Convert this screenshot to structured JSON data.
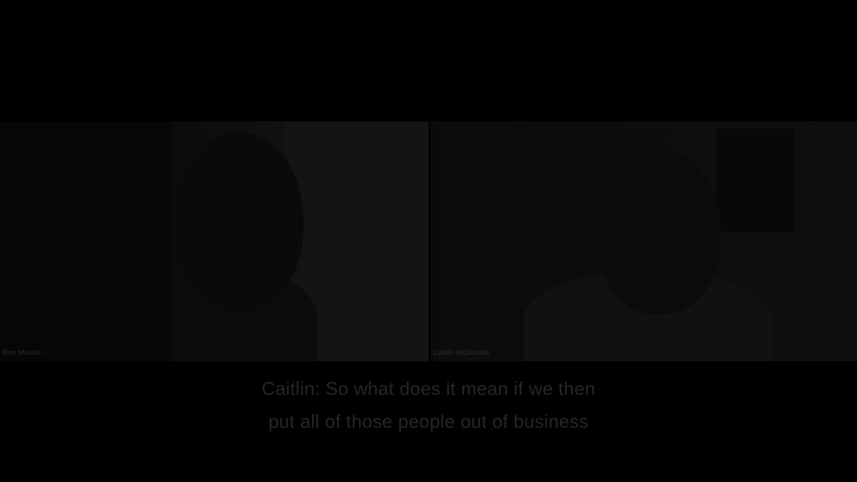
{
  "video_call": {
    "participants": [
      {
        "name": "Ben Mosior -..."
      },
      {
        "name": "Caitlin McDonald"
      }
    ]
  },
  "captions": {
    "line1": "Caitlin: So what does it mean if we then",
    "line2": "put all of those people out of business"
  },
  "colors": {
    "background": "#000000",
    "caption_text": "#262626",
    "name_text": "#2d2d2d"
  }
}
